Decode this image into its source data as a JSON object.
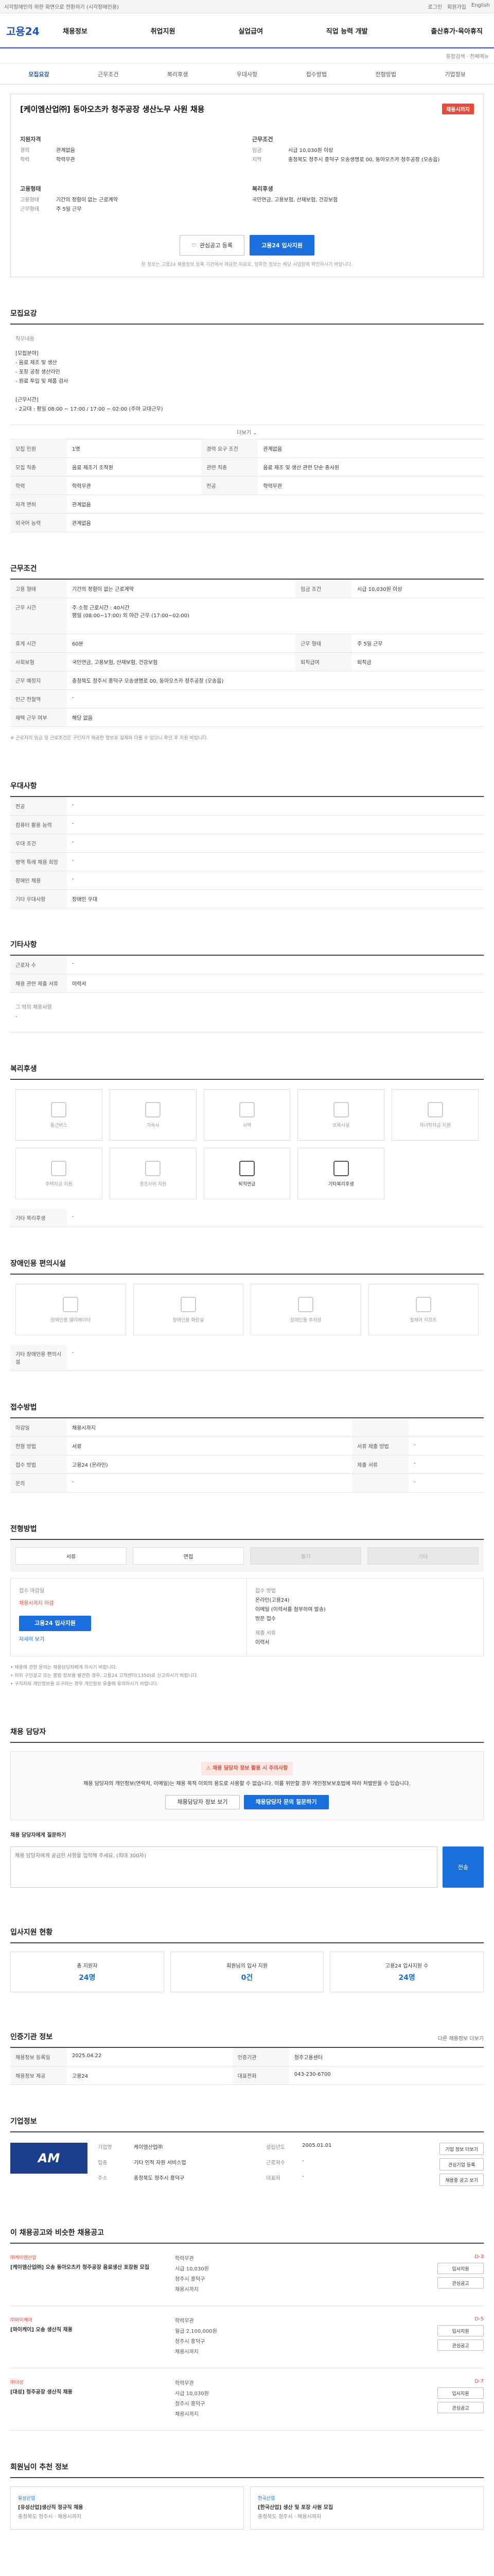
{
  "topbar": {
    "left": "시각장애인의 위한 화면으로 전환하기 (시각장애인용)",
    "links": [
      "로그인",
      "회원가입",
      "English"
    ]
  },
  "header": {
    "logo": "고용24",
    "nav": [
      "채용정보",
      "취업지원",
      "실업급여",
      "직업 능력 개발",
      "출산휴가·육아휴직"
    ]
  },
  "searchrow": {
    "text": "통합검색 · 전체메뉴"
  },
  "tabs": [
    "모집요강",
    "근무조건",
    "복리후생",
    "우대사항",
    "접수방법",
    "전형방법",
    "기업정보"
  ],
  "job": {
    "title": "[케이엠산업㈜] 동아오츠카 청주공장 생산노무 사원 채용",
    "badge": "채용시까지",
    "left_head": "지원자격",
    "left": [
      {
        "k": "경력",
        "v": "관계없음"
      },
      {
        "k": "학력",
        "v": "학력무관"
      }
    ],
    "right_head": "근무조건",
    "right": [
      {
        "k": "임금",
        "v": "시급 10,030원 이상"
      },
      {
        "k": "지역",
        "v": "충청북도 청주시 흥덕구 오송생명로 00, 동아오츠카 청주공장 (오송읍)"
      }
    ],
    "left2_head": "고용형태",
    "left2": [
      {
        "k": "고용형태",
        "v": "기간의 정함이 없는 근로계약"
      },
      {
        "k": "근무형태",
        "v": "주 5일 근무"
      }
    ],
    "right2_head": "복리후생",
    "right2": [
      {
        "k": "",
        "v": "국민연금, 고용보험, 산재보험, 건강보험"
      }
    ],
    "btn_scrap": "관심공고 등록",
    "btn_apply": "고용24 입사지원",
    "note": "본 정보는 고용24 채용정보 등록 기관에서 제공한 자료로, 정확한 정보는 해당 사업장에 확인하시기 바랍니다."
  },
  "recruit": {
    "title": "모집요강",
    "desc_label": "직무내용",
    "desc": [
      "[모집분야]",
      "- 음료 제조 및 생산",
      "- 포장 공정 생산라인",
      "- 원료 투입 및 제품 검사",
      "",
      "[근무시간]",
      "- 2교대 : 평일 08:00 ~ 17:00 / 17:00 ~ 02:00 (주야 교대근무)"
    ],
    "more": "더보기",
    "rows": [
      {
        "k": "모집 인원",
        "v": "1명",
        "k2": "경력 요구 조건",
        "v2": "관계없음"
      },
      {
        "k": "모집 직종",
        "v": "음료 제조기 조작원",
        "k2": "관련 직종",
        "v2": "음료 제조 및 생산 관련 단순 종사원"
      },
      {
        "k": "학력",
        "v": "학력무관",
        "k2": "전공",
        "v2": "학력무관"
      },
      {
        "k": "자격 면허",
        "v": "관계없음"
      },
      {
        "k": "외국어 능력",
        "v": "관계없음"
      }
    ]
  },
  "conditions": {
    "title": "근무조건",
    "rows": [
      {
        "k": "고용 형태",
        "v": "기간의 정함이 없는 근로계약",
        "k2": "임금 조건",
        "v2": "시급 10,030원 이상"
      },
      {
        "k": "근무 시간",
        "v": "주 소정 근로시간 : 40시간\n평일 (08:00~17:00) 외 야간 근무 (17:00~02:00)"
      },
      {
        "k": "휴게 시간",
        "v": "60분",
        "k2": "근무 형태",
        "v2": "주 5일 근무"
      },
      {
        "k": "사회보험",
        "v": "국민연금, 고용보험, 산재보험, 건강보험",
        "k2": "퇴직급여",
        "v2": "퇴직금"
      },
      {
        "k": "근무 예정지",
        "v": "충청북도 청주시 흥덕구 오송생명로 00, 동아오츠카 청주공장 (오송읍)"
      },
      {
        "k": "인근 전철역",
        "v": "-"
      },
      {
        "k": "재택 근무 여부",
        "v": "해당 없음"
      }
    ],
    "note": "※ 근로자의 임금 및 근로조건은 구인자가 제공한 정보로 실제와 다를 수 있으니 확인 후 지원 바랍니다."
  },
  "preference": {
    "title": "우대사항",
    "rows": [
      {
        "k": "전공",
        "v": "-"
      },
      {
        "k": "컴퓨터 활용 능력",
        "v": "-"
      },
      {
        "k": "우대 조건",
        "v": "-"
      },
      {
        "k": "병역 특례 채용 희망",
        "v": "-"
      },
      {
        "k": "장애인 채용",
        "v": "-"
      },
      {
        "k": "기타 우대사항",
        "v": "장애인 우대"
      }
    ]
  },
  "other": {
    "title": "기타사항",
    "rows": [
      {
        "k": "근로자 수",
        "v": "-"
      },
      {
        "k": "채용 관련 제출 서류",
        "v": "이력서"
      }
    ],
    "extra_label": "그 밖의 채용사항",
    "extra_value": "-"
  },
  "welfare": {
    "title": "복리후생",
    "items": [
      "통근버스",
      "기숙사",
      "사택",
      "보육시설",
      "자녀학자금 지원",
      "주택자금 지원",
      "경조사비 지원",
      "퇴직연금",
      "기타복리후생"
    ],
    "other_label": "기타 복리후생",
    "other_value": "-"
  },
  "disability": {
    "title": "장애인용 편의시설",
    "items": [
      "장애인용 엘리베이터",
      "장애인용 화장실",
      "장애인용 주차장",
      "휠체어 리프트"
    ],
    "other_label": "기타 장애인용 편의시설",
    "other_value": "-"
  },
  "apply": {
    "title": "접수방법",
    "rows": [
      {
        "k": "마감일",
        "v": "채용시까지",
        "k2": "",
        "v2": ""
      },
      {
        "k": "전형 방법",
        "v": "서류",
        "k2": "서류 제출 방법",
        "v2": "-"
      },
      {
        "k": "접수 방법",
        "v": "고용24 (온라인)",
        "k2": "제출 서류",
        "v2": "-"
      },
      {
        "k": "문의",
        "v": "-",
        "k2": "",
        "v2": "-"
      }
    ]
  },
  "screening": {
    "title": "전형방법",
    "buttons": [
      "서류",
      "면접",
      "필기",
      "기타"
    ],
    "left_head": "접수 마감일",
    "left_val": "채용시까지 마감",
    "left_apply": "고용24 입사지원",
    "left_link": "자세히 보기",
    "right_head": "접수 방법",
    "right": [
      "온라인(고용24)",
      "이메일 (이력서를 첨부하여 발송)",
      "방문 접수"
    ],
    "right_head2": "제출 서류",
    "right2": "이력서"
  },
  "notes": [
    "• 채용에 관한 문의는 채용담당자에게 하시기 바랍니다.",
    "• 허위 구인광고 또는 불법 정보를 발견한 경우, 고용24 고객센터(1350)로 신고하시기 바랍니다.",
    "• 구직자의 개인정보를 요구하는 경우 개인정보 유출에 유의하시기 바랍니다."
  ],
  "contact": {
    "title": "채용 담당자",
    "warn_head": "채용 담당자 정보 활용 시 주의사항",
    "warn_text": "채용 담당자의 개인정보(연락처, 이메일)는 채용 목적 이외의 용도로 사용할 수 없습니다. 이를 위반할 경우 개인정보보호법에 따라 처벌받을 수 있습니다.",
    "btn_view": "채용담당자 정보 보기",
    "btn_inquiry": "채용담당자 문의 질문하기",
    "inquiry_label": "채용 담당자에게 질문하기",
    "inquiry_placeholder": "채용 담당자에게 궁금한 사항을 입력해 주세요. (최대 300자)",
    "inquiry_btn": "전송"
  },
  "stats": {
    "title": "입사지원 현황",
    "items": [
      {
        "label": "총 지원자",
        "value": "24명"
      },
      {
        "label": "회원님의 입사 지원",
        "value": "0건"
      },
      {
        "label": "고용24 입사지원 수",
        "value": "24명"
      }
    ]
  },
  "registration": {
    "title": "인증기관 정보",
    "rows": [
      {
        "k": "채용정보 등록일",
        "v": "2025.04.22",
        "k2": "인증기관",
        "v2": "청주고용센터"
      },
      {
        "k": "채용정보 제공",
        "v": "고용24",
        "k2": "대표전화",
        "v2": "043-230-6700"
      }
    ],
    "btn": "다른 채용정보 더보기"
  },
  "company": {
    "title": "기업정보",
    "logo": "AM",
    "info": [
      {
        "k": "기업명",
        "v": "케이엠산업㈜"
      },
      {
        "k": "설립년도",
        "v": "2005.01.01"
      },
      {
        "k": "업종",
        "v": "기타 인적 자원 서비스업"
      },
      {
        "k": "근로자수",
        "v": "-"
      },
      {
        "k": "주소",
        "v": "충청북도 청주시 흥덕구"
      },
      {
        "k": "대표자",
        "v": "-"
      }
    ],
    "actions": [
      "기업 정보 더보기",
      "관심기업 등록",
      "채용중 공고 보기"
    ]
  },
  "recommend": {
    "title": "이 채용공고와 비슷한 채용공고",
    "items": [
      {
        "company": "㈜케이엠산업",
        "title": "[케이엠산업㈜] 오송 동아오츠카 청주공장 음료생산 포장원 모집",
        "details": [
          "학력무관",
          "시급 10,030원",
          "청주시 흥덕구",
          "채용시까지"
        ],
        "badge": "D-3"
      },
      {
        "company": "㈜와이케이",
        "title": "[와이케이] 오송 생산직 채용",
        "details": [
          "학력무관",
          "월급 2,100,000원",
          "청주시 흥덕구",
          "채용시까지"
        ],
        "badge": "D-5"
      },
      {
        "company": "㈜대성",
        "title": "[대성] 청주공장 생산직 채용",
        "details": [
          "학력무관",
          "시급 10,030원",
          "청주시 흥덕구",
          "채용시까지"
        ],
        "badge": "D-7"
      }
    ],
    "item_btns": [
      "입사지원",
      "관심공고"
    ]
  },
  "picks": {
    "title": "회원님이 추천 정보",
    "items": [
      {
        "company": "유성산업",
        "title": "[유성산업]생산직 정규직 채용",
        "meta": "충청북도 청주시 · 채용시까지"
      },
      {
        "company": "한국산업",
        "title": "[한국산업] 생산 및 포장 사원 모집",
        "meta": "충청북도 청주시 · 채용시까지"
      }
    ]
  }
}
